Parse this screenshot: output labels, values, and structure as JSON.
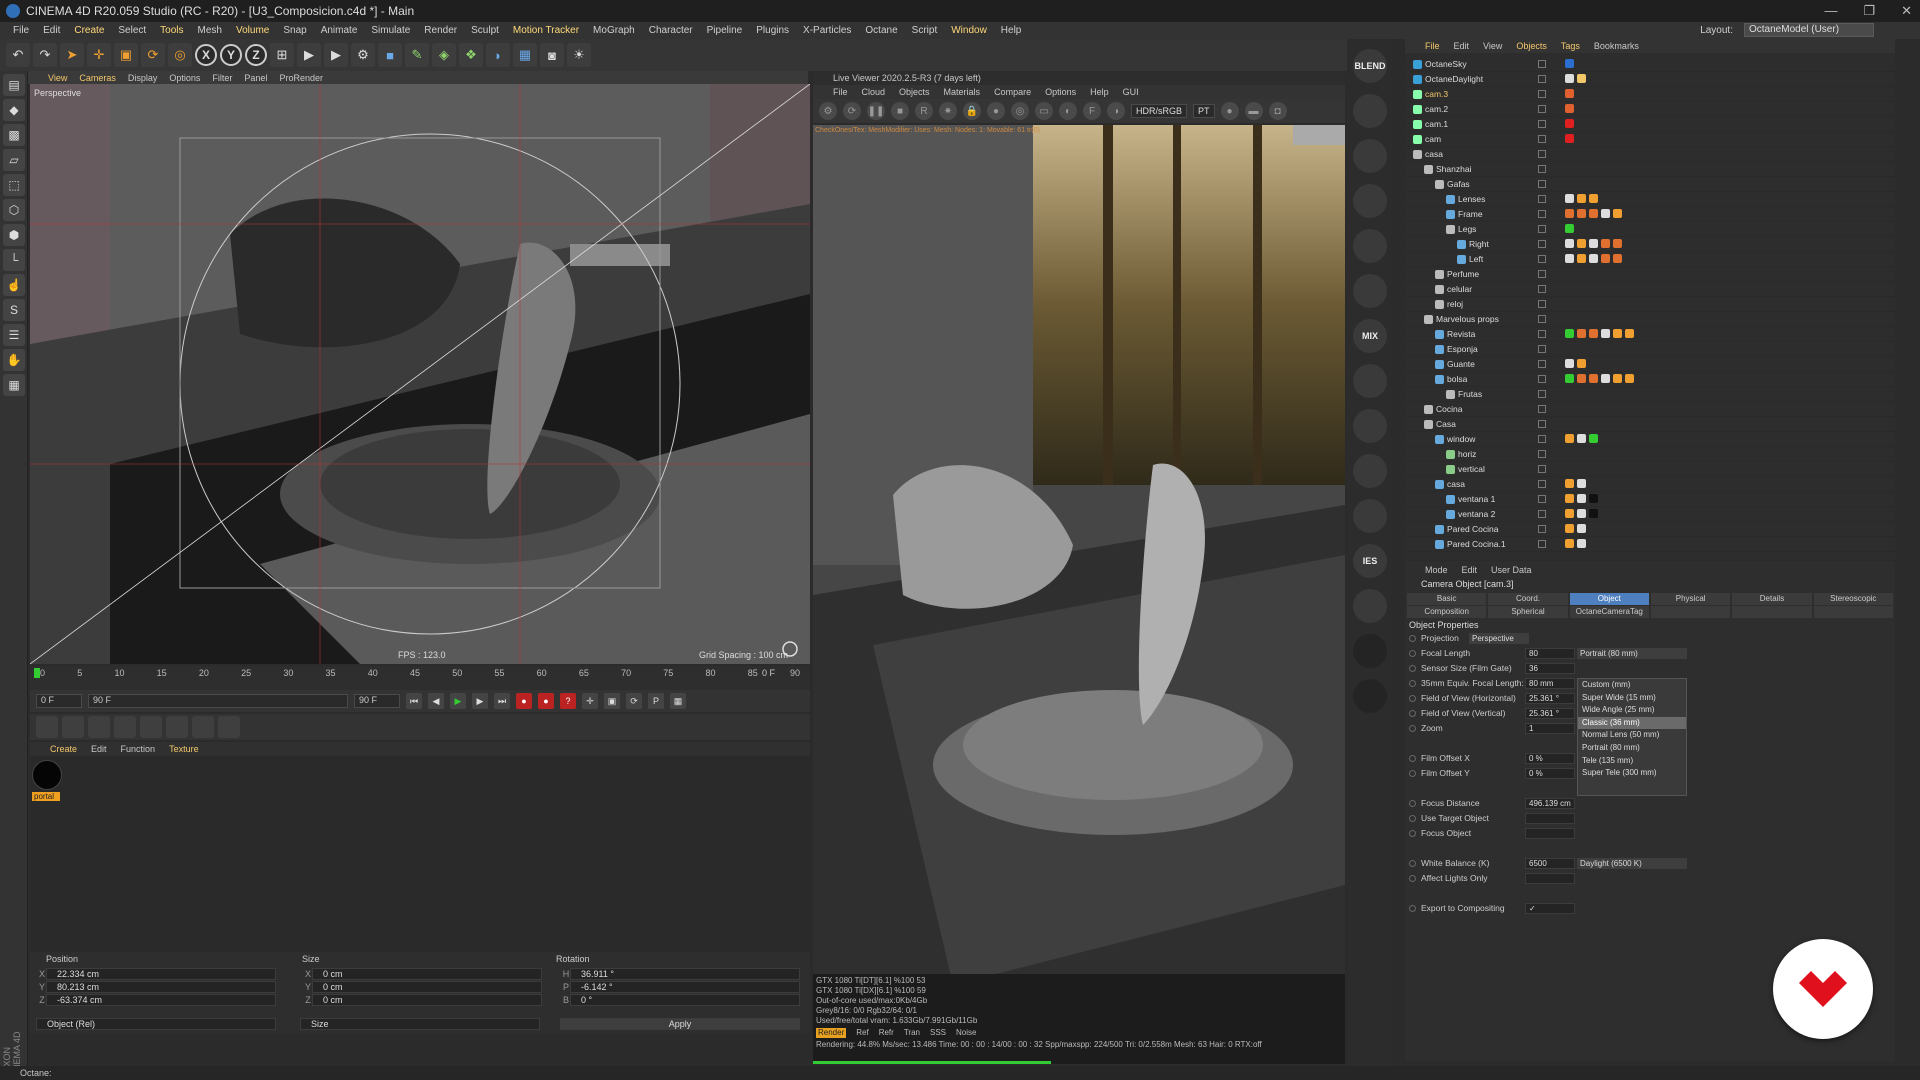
{
  "window": {
    "title": "CINEMA 4D R20.059 Studio (RC - R20) - [U3_Composicion.c4d *] - Main",
    "controls": [
      "—",
      "❐",
      "✕"
    ]
  },
  "menubar": {
    "items": [
      "File",
      "Edit",
      "Create",
      "Select",
      "Tools",
      "Mesh",
      "Volume",
      "Snap",
      "Animate",
      "Simulate",
      "Render",
      "Sculpt",
      "Motion Tracker",
      "MoGraph",
      "Character",
      "Pipeline",
      "Plugins",
      "X-Particles",
      "Octane",
      "Script",
      "Window",
      "Help"
    ],
    "layout_label": "Layout:",
    "layout_value": "OctaneModel (User)"
  },
  "viewport": {
    "menu": [
      "View",
      "Cameras",
      "Display",
      "Options",
      "Filter",
      "Panel",
      "ProRender"
    ],
    "label": "Perspective",
    "fps": "FPS : 123.0",
    "grid": "Grid Spacing : 100 cm"
  },
  "timeline": {
    "ticks": [
      "0",
      "5",
      "10",
      "15",
      "20",
      "25",
      "30",
      "35",
      "40",
      "45",
      "50",
      "55",
      "60",
      "65",
      "70",
      "75",
      "80",
      "85",
      "90"
    ],
    "current": "0 F",
    "start": "0 F",
    "end_field": "90 F",
    "end2": "90 F",
    "right": "0 F"
  },
  "material_manager": {
    "menu": [
      "Create",
      "Edit",
      "Function",
      "Texture"
    ],
    "material_name": "portal"
  },
  "coordinates": {
    "headers": [
      "Position",
      "Size",
      "Rotation"
    ],
    "rows": [
      {
        "a": "X",
        "p": "22.334 cm",
        "s": "0 cm",
        "r_ax": "H",
        "r": "36.911 °"
      },
      {
        "a": "Y",
        "p": "80.213 cm",
        "s": "0 cm",
        "r_ax": "P",
        "r": "-6.142 °"
      },
      {
        "a": "Z",
        "p": "-63.374 cm",
        "s": "0 cm",
        "r_ax": "B",
        "r": "0 °"
      }
    ],
    "mode": "Object (Rel)",
    "size_mode": "Size",
    "apply": "Apply"
  },
  "status": {
    "text": "Octane:",
    "maxon": "MAXON CINEMA 4D"
  },
  "liveviewer": {
    "title": "Live Viewer 2020.2.5-R3 (7 days left)",
    "menu": [
      "File",
      "Cloud",
      "Objects",
      "Materials",
      "Compare",
      "Options",
      "Help",
      "GUI"
    ],
    "color_mode": "HDR/sRGB",
    "kernel": "PT",
    "info": "CheckOnes/Tex: MeshModifier: Uses: Mesh: Nodes: 1: Movable: 61 tr(0)"
  },
  "gpu": {
    "lines": [
      "GTX 1080 Ti[DT][6.1]     %100    53",
      "GTX 1080 Ti[DX][6.1]     %100    59",
      "Out-of-core used/max:0Kb/4Gb",
      "Grey8/16: 0/0        Rgb32/64: 0/1",
      "Used/free/total vram: 1.633Gb/7.991Gb/11Gb"
    ],
    "passes": [
      "Render",
      "Ref",
      "Refr",
      "Tran",
      "SSS",
      "Noise"
    ],
    "render_line": "Rendering: 44.8%    Ms/sec: 13.486    Time: 00 : 00 : 14/00 : 00 : 32   Spp/maxspp: 224/500   Tri: 0/2.558m   Mesh: 63   Hair: 0   RTX:off",
    "progress": 0.448
  },
  "octane_toolbar": [
    "BLEND",
    "",
    "",
    "",
    "",
    "",
    "MIX",
    "",
    "",
    "",
    "",
    "IES",
    "",
    "",
    ""
  ],
  "object_manager": {
    "menu": [
      "File",
      "Edit",
      "View",
      "Objects",
      "Tags",
      "Bookmarks"
    ],
    "rows": [
      {
        "name": "OctaneSky",
        "indent": 0,
        "icon": "#3aa0d8",
        "tags": [
          "#2a6fd0"
        ]
      },
      {
        "name": "OctaneDaylight",
        "indent": 0,
        "icon": "#3aa0d8",
        "tags": [
          "#ddd",
          "#f2c76a"
        ]
      },
      {
        "name": "cam.3",
        "indent": 0,
        "icon": "#8fa",
        "tags": [
          "#e06030"
        ],
        "sel": true
      },
      {
        "name": "cam.2",
        "indent": 0,
        "icon": "#8fa",
        "tags": [
          "#e06030"
        ]
      },
      {
        "name": "cam.1",
        "indent": 0,
        "icon": "#8fa",
        "tags": [
          "#e02020"
        ]
      },
      {
        "name": "cam",
        "indent": 0,
        "icon": "#8fa",
        "tags": [
          "#e02020"
        ]
      },
      {
        "name": "casa",
        "indent": 0,
        "icon": "#bbb",
        "tags": []
      },
      {
        "name": "Shanzhai",
        "indent": 1,
        "icon": "#bbb",
        "tags": []
      },
      {
        "name": "Gafas",
        "indent": 2,
        "icon": "#bbb",
        "tags": []
      },
      {
        "name": "Lenses",
        "indent": 3,
        "icon": "#6ad",
        "tags": [
          "#ddd",
          "#f0a030",
          "#f0a030"
        ]
      },
      {
        "name": "Frame",
        "indent": 3,
        "icon": "#6ad",
        "tags": [
          "#e07030",
          "#e07030",
          "#e07030",
          "#ddd",
          "#f0a030"
        ]
      },
      {
        "name": "Legs",
        "indent": 3,
        "icon": "#bbb",
        "tags": [
          "#3c3"
        ]
      },
      {
        "name": "Right",
        "indent": 4,
        "icon": "#6ad",
        "tags": [
          "#ddd",
          "#f0a030",
          "#ddd",
          "#e07030",
          "#e07030"
        ]
      },
      {
        "name": "Left",
        "indent": 4,
        "icon": "#6ad",
        "tags": [
          "#ddd",
          "#f0a030",
          "#ddd",
          "#e07030",
          "#e07030"
        ]
      },
      {
        "name": "Perfume",
        "indent": 2,
        "icon": "#bbb",
        "tags": []
      },
      {
        "name": "celular",
        "indent": 2,
        "icon": "#bbb",
        "tags": []
      },
      {
        "name": "reloj",
        "indent": 2,
        "icon": "#bbb",
        "tags": []
      },
      {
        "name": "Marvelous props",
        "indent": 1,
        "icon": "#bbb",
        "tags": []
      },
      {
        "name": "Revista",
        "indent": 2,
        "icon": "#6ad",
        "tags": [
          "#3c3",
          "#e07030",
          "#e07030",
          "#ddd",
          "#f0a030",
          "#f0a030"
        ]
      },
      {
        "name": "Esponja",
        "indent": 2,
        "icon": "#6ad",
        "tags": []
      },
      {
        "name": "Guante",
        "indent": 2,
        "icon": "#6ad",
        "tags": [
          "#ddd",
          "#f0a030"
        ]
      },
      {
        "name": "bolsa",
        "indent": 2,
        "icon": "#6ad",
        "tags": [
          "#3c3",
          "#e07030",
          "#e07030",
          "#ddd",
          "#f0a030",
          "#f0a030"
        ]
      },
      {
        "name": "Frutas",
        "indent": 3,
        "icon": "#bbb",
        "tags": []
      },
      {
        "name": "Cocina",
        "indent": 1,
        "icon": "#bbb",
        "tags": []
      },
      {
        "name": "Casa",
        "indent": 1,
        "icon": "#bbb",
        "tags": []
      },
      {
        "name": "window",
        "indent": 2,
        "icon": "#6ad",
        "tags": [
          "#f0a030",
          "#ddd",
          "#3c3"
        ]
      },
      {
        "name": "horiz",
        "indent": 3,
        "icon": "#8c8",
        "tags": []
      },
      {
        "name": "vertical",
        "indent": 3,
        "icon": "#8c8",
        "tags": []
      },
      {
        "name": "casa",
        "indent": 2,
        "icon": "#6ad",
        "tags": [
          "#f0a030",
          "#ddd"
        ]
      },
      {
        "name": "ventana 1",
        "indent": 3,
        "icon": "#6ad",
        "tags": [
          "#f0a030",
          "#ddd",
          "#111"
        ]
      },
      {
        "name": "ventana 2",
        "indent": 3,
        "icon": "#6ad",
        "tags": [
          "#f0a030",
          "#ddd",
          "#111"
        ]
      },
      {
        "name": "Pared Cocina",
        "indent": 2,
        "icon": "#6ad",
        "tags": [
          "#f0a030",
          "#ddd"
        ]
      },
      {
        "name": "Pared Cocina.1",
        "indent": 2,
        "icon": "#6ad",
        "tags": [
          "#f0a030",
          "#ddd"
        ]
      }
    ]
  },
  "attributes": {
    "menu": [
      "Mode",
      "Edit",
      "User Data"
    ],
    "title": "Camera Object [cam.3]",
    "tabs1": [
      "Basic",
      "Coord.",
      "Object",
      "Physical",
      "Details",
      "Stereoscopic"
    ],
    "active_tab": "Object",
    "tabs2": [
      "Composition",
      "Spherical",
      "OctaneCameraTag"
    ],
    "section": "Object Properties",
    "projection_label": "Projection",
    "projection": "Perspective",
    "props": [
      {
        "label": "Focal Length",
        "value": "80",
        "dropdown": "Portrait (80 mm)"
      },
      {
        "label": "Sensor Size (Film Gate)",
        "value": "36",
        "dropdown": ""
      },
      {
        "label": "35mm Equiv. Focal Length:",
        "value": "80 mm",
        "dropdown": ""
      },
      {
        "label": "Field of View (Horizontal)",
        "value": "25.361 °",
        "dropdown": ""
      },
      {
        "label": "Field of View (Vertical)",
        "value": "25.361 °",
        "dropdown": ""
      },
      {
        "label": "Zoom",
        "value": "1",
        "dropdown": ""
      },
      {
        "label": "",
        "value": "",
        "dropdown": ""
      },
      {
        "label": "Film Offset X",
        "value": "0 %",
        "dropdown": ""
      },
      {
        "label": "Film Offset Y",
        "value": "0 %",
        "dropdown": ""
      },
      {
        "label": "",
        "value": "",
        "dropdown": ""
      },
      {
        "label": "Focus Distance",
        "value": "496.139 cm",
        "dropdown": ""
      },
      {
        "label": "Use Target Object",
        "value": "",
        "dropdown": ""
      },
      {
        "label": "Focus Object",
        "value": "",
        "dropdown": ""
      },
      {
        "label": "",
        "value": "",
        "dropdown": ""
      },
      {
        "label": "White Balance (K)",
        "value": "6500",
        "dropdown": "Daylight (6500 K)"
      },
      {
        "label": "Affect Lights Only",
        "value": "",
        "dropdown": ""
      },
      {
        "label": "",
        "value": "",
        "dropdown": ""
      },
      {
        "label": "Export to Compositing",
        "value": "✓",
        "dropdown": ""
      }
    ],
    "lens_options": [
      "Custom (mm)",
      "Super Wide (15 mm)",
      "Wide Angle (25 mm)",
      "Classic (36 mm)",
      "Normal Lens (50 mm)",
      "Portrait (80 mm)",
      "Tele (135 mm)",
      "Super Tele (300 mm)"
    ],
    "highlighted_option": "Classic (36 mm)"
  },
  "colors": {
    "accent": "#f2c76a",
    "brand": "#e0101c",
    "active_tab": "#4e7fbf"
  }
}
